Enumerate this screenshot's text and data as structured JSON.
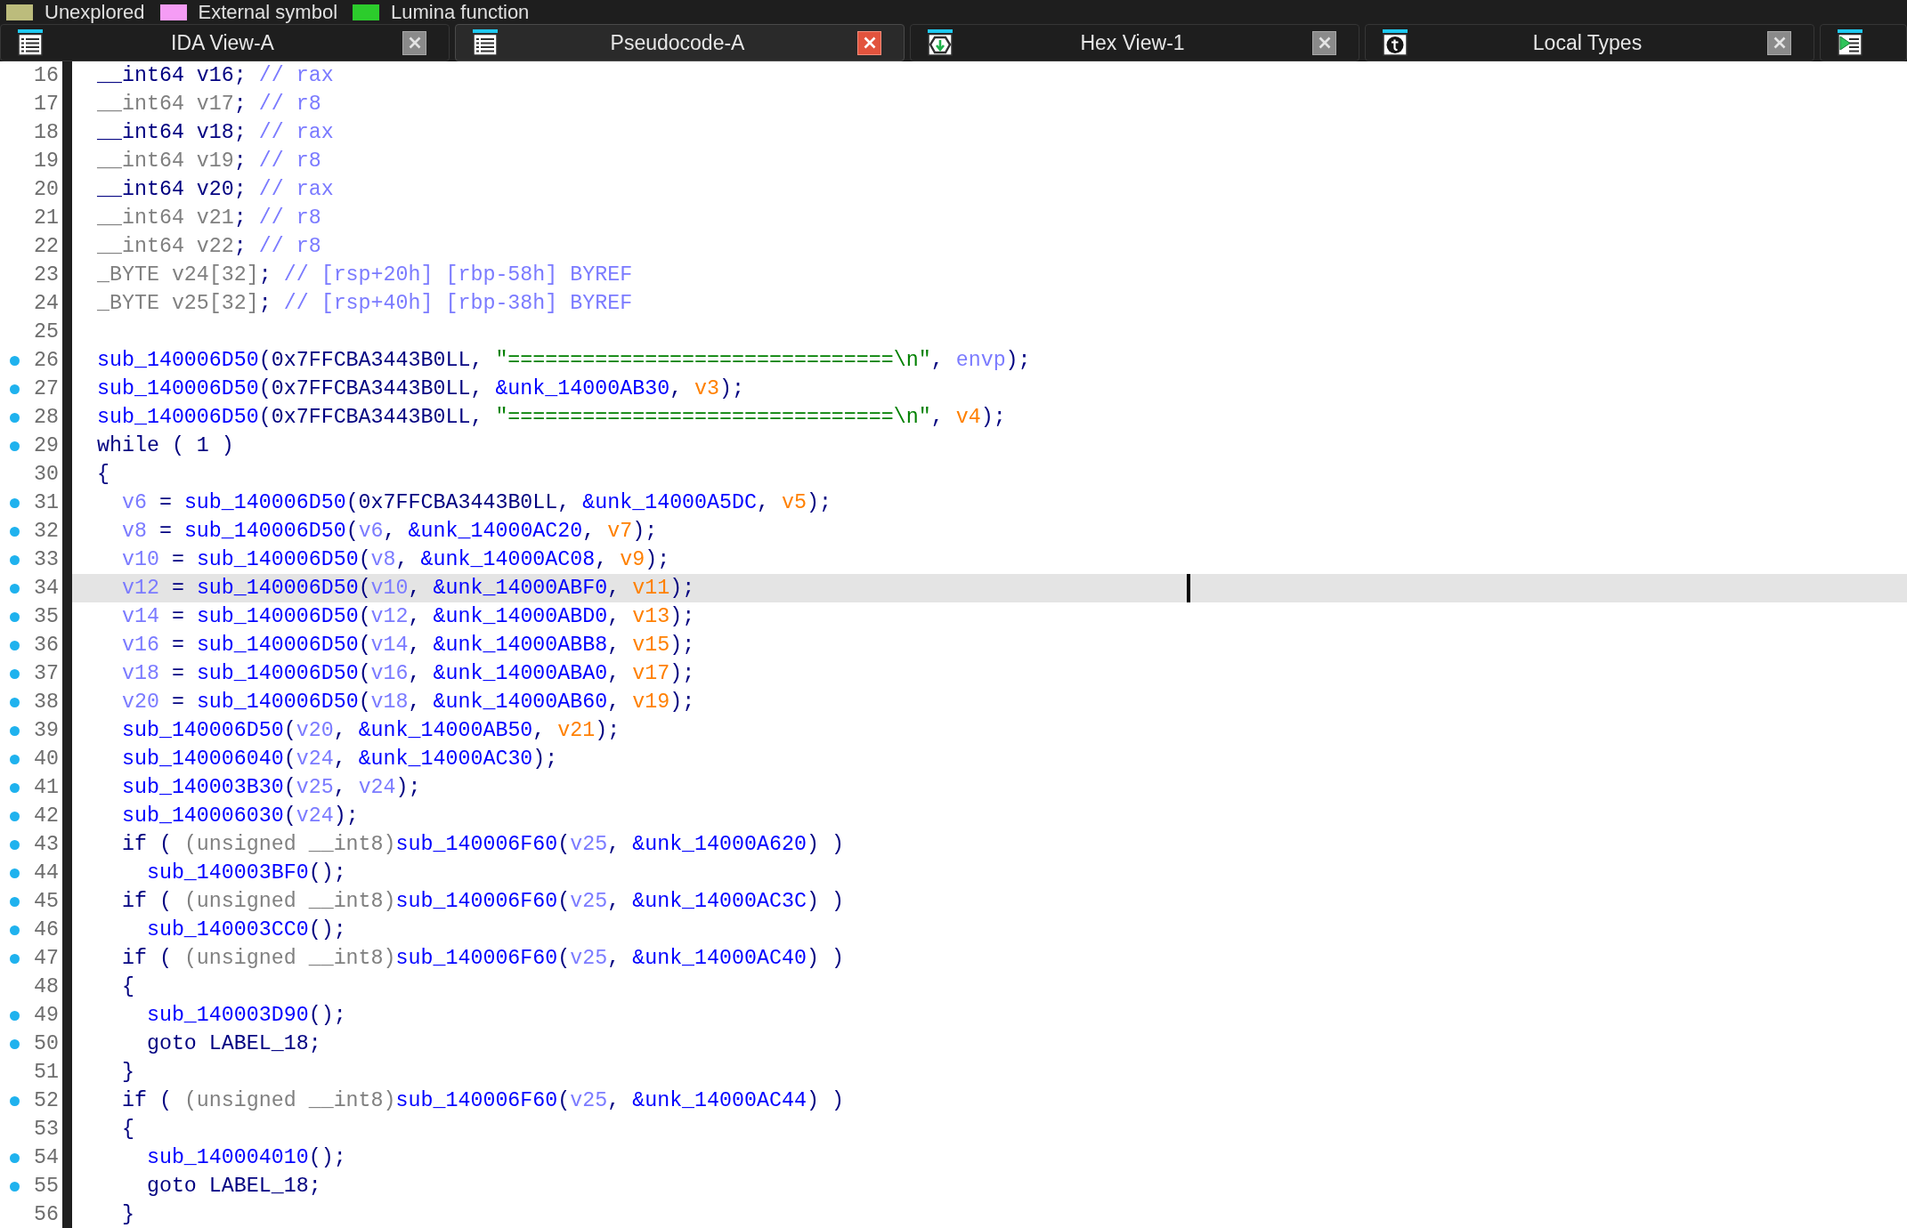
{
  "legend": [
    {
      "label": "Unexplored",
      "color": "#bcbc7c"
    },
    {
      "label": "External symbol",
      "color": "#f59cf5"
    },
    {
      "label": "Lumina function",
      "color": "#2ccc2c"
    }
  ],
  "tabs": [
    {
      "kind": "listing",
      "label": "IDA View-A",
      "selected": false,
      "closable": true
    },
    {
      "kind": "listing",
      "label": "Pseudocode-A",
      "selected": true,
      "closable": true
    },
    {
      "kind": "hex",
      "label": "Hex View-1",
      "selected": false,
      "closable": true
    },
    {
      "kind": "types",
      "label": "Local Types",
      "selected": false,
      "closable": true
    },
    {
      "kind": "exports",
      "selected": false
    }
  ],
  "code": {
    "lines": [
      {
        "number": "16",
        "marker": false,
        "selected": false,
        "tokens": [
          {
            "kind": "plain",
            "text": "__int64 v16; "
          },
          {
            "kind": "comment",
            "text": "// rax"
          }
        ]
      },
      {
        "number": "17",
        "marker": false,
        "selected": false,
        "tokens": [
          {
            "kind": "dim",
            "text": "__int64 v17"
          },
          {
            "kind": "plain",
            "text": "; "
          },
          {
            "kind": "comment",
            "text": "// r8"
          }
        ]
      },
      {
        "number": "18",
        "marker": false,
        "selected": false,
        "tokens": [
          {
            "kind": "plain",
            "text": "__int64 v18; "
          },
          {
            "kind": "comment",
            "text": "// rax"
          }
        ]
      },
      {
        "number": "19",
        "marker": false,
        "selected": false,
        "tokens": [
          {
            "kind": "dim",
            "text": "__int64 v19"
          },
          {
            "kind": "plain",
            "text": "; "
          },
          {
            "kind": "comment",
            "text": "// r8"
          }
        ]
      },
      {
        "number": "20",
        "marker": false,
        "selected": false,
        "tokens": [
          {
            "kind": "plain",
            "text": "__int64 v20; "
          },
          {
            "kind": "comment",
            "text": "// rax"
          }
        ]
      },
      {
        "number": "21",
        "marker": false,
        "selected": false,
        "tokens": [
          {
            "kind": "dim",
            "text": "__int64 v21"
          },
          {
            "kind": "plain",
            "text": "; "
          },
          {
            "kind": "comment",
            "text": "// r8"
          }
        ]
      },
      {
        "number": "22",
        "marker": false,
        "selected": false,
        "tokens": [
          {
            "kind": "dim",
            "text": "__int64 v22"
          },
          {
            "kind": "plain",
            "text": "; "
          },
          {
            "kind": "comment",
            "text": "// r8"
          }
        ]
      },
      {
        "number": "23",
        "marker": false,
        "selected": false,
        "tokens": [
          {
            "kind": "dim",
            "text": "_BYTE v24[32]"
          },
          {
            "kind": "plain",
            "text": "; "
          },
          {
            "kind": "comment",
            "text": "// [rsp+20h] [rbp-58h] BYREF"
          }
        ]
      },
      {
        "number": "24",
        "marker": false,
        "selected": false,
        "tokens": [
          {
            "kind": "dim",
            "text": "_BYTE v25[32]"
          },
          {
            "kind": "plain",
            "text": "; "
          },
          {
            "kind": "comment",
            "text": "// [rsp+40h] [rbp-38h] BYREF"
          }
        ]
      },
      {
        "number": "25",
        "marker": false,
        "selected": false
      },
      {
        "number": "26",
        "marker": true,
        "selected": false,
        "tokens": [
          {
            "kind": "name",
            "text": "sub_140006D50"
          },
          {
            "kind": "plain",
            "text": "(0x7FFCBA3443B0LL, "
          },
          {
            "kind": "string",
            "text": "\"===============================\\n\""
          },
          {
            "kind": "plain",
            "text": ", "
          },
          {
            "kind": "local",
            "text": "envp"
          },
          {
            "kind": "plain",
            "text": ");"
          }
        ]
      },
      {
        "number": "27",
        "marker": true,
        "selected": false,
        "tokens": [
          {
            "kind": "name",
            "text": "sub_140006D50"
          },
          {
            "kind": "plain",
            "text": "(0x7FFCBA3443B0LL, "
          },
          {
            "kind": "name",
            "text": "&unk_14000AB30"
          },
          {
            "kind": "plain",
            "text": ", "
          },
          {
            "kind": "arg",
            "text": "v3"
          },
          {
            "kind": "plain",
            "text": ");"
          }
        ]
      },
      {
        "number": "28",
        "marker": true,
        "selected": false,
        "tokens": [
          {
            "kind": "name",
            "text": "sub_140006D50"
          },
          {
            "kind": "plain",
            "text": "(0x7FFCBA3443B0LL, "
          },
          {
            "kind": "string",
            "text": "\"===============================\\n\""
          },
          {
            "kind": "plain",
            "text": ", "
          },
          {
            "kind": "arg",
            "text": "v4"
          },
          {
            "kind": "plain",
            "text": ");"
          }
        ]
      },
      {
        "number": "29",
        "marker": true,
        "selected": false,
        "tokens": [
          {
            "kind": "plain",
            "text": "while ( 1 )"
          }
        ]
      },
      {
        "number": "30",
        "marker": false,
        "selected": false,
        "tokens": [
          {
            "kind": "plain",
            "text": "{"
          }
        ]
      },
      {
        "number": "31",
        "marker": true,
        "selected": false,
        "tokens": [
          {
            "kind": "local",
            "text": "  v6"
          },
          {
            "kind": "plain",
            "text": " = "
          },
          {
            "kind": "name",
            "text": "sub_140006D50"
          },
          {
            "kind": "plain",
            "text": "(0x7FFCBA3443B0LL, "
          },
          {
            "kind": "name",
            "text": "&unk_14000A5DC"
          },
          {
            "kind": "plain",
            "text": ", "
          },
          {
            "kind": "arg",
            "text": "v5"
          },
          {
            "kind": "plain",
            "text": ");"
          }
        ]
      },
      {
        "number": "32",
        "marker": true,
        "selected": false,
        "tokens": [
          {
            "kind": "local",
            "text": "  v8"
          },
          {
            "kind": "plain",
            "text": " = "
          },
          {
            "kind": "name",
            "text": "sub_140006D50"
          },
          {
            "kind": "plain",
            "text": "("
          },
          {
            "kind": "local",
            "text": "v6"
          },
          {
            "kind": "plain",
            "text": ", "
          },
          {
            "kind": "name",
            "text": "&unk_14000AC20"
          },
          {
            "kind": "plain",
            "text": ", "
          },
          {
            "kind": "arg",
            "text": "v7"
          },
          {
            "kind": "plain",
            "text": ");"
          }
        ]
      },
      {
        "number": "33",
        "marker": true,
        "selected": false,
        "tokens": [
          {
            "kind": "local",
            "text": "  v10"
          },
          {
            "kind": "plain",
            "text": " = "
          },
          {
            "kind": "name",
            "text": "sub_140006D50"
          },
          {
            "kind": "plain",
            "text": "("
          },
          {
            "kind": "local",
            "text": "v8"
          },
          {
            "kind": "plain",
            "text": ", "
          },
          {
            "kind": "name",
            "text": "&unk_14000AC08"
          },
          {
            "kind": "plain",
            "text": ", "
          },
          {
            "kind": "arg",
            "text": "v9"
          },
          {
            "kind": "plain",
            "text": ");"
          }
        ]
      },
      {
        "number": "34",
        "marker": true,
        "selected": true,
        "tokens": [
          {
            "kind": "local",
            "text": "  v12"
          },
          {
            "kind": "plain",
            "text": " = "
          },
          {
            "kind": "name",
            "text": "sub_140006D50"
          },
          {
            "kind": "plain",
            "text": "("
          },
          {
            "kind": "local",
            "text": "v10"
          },
          {
            "kind": "plain",
            "text": ", "
          },
          {
            "kind": "name",
            "text": "&unk_14000ABF0"
          },
          {
            "kind": "plain",
            "text": ", "
          },
          {
            "kind": "arg",
            "text": "v11"
          },
          {
            "kind": "plain",
            "text": ");"
          }
        ]
      },
      {
        "number": "35",
        "marker": true,
        "selected": false,
        "tokens": [
          {
            "kind": "local",
            "text": "  v14"
          },
          {
            "kind": "plain",
            "text": " = "
          },
          {
            "kind": "name",
            "text": "sub_140006D50"
          },
          {
            "kind": "plain",
            "text": "("
          },
          {
            "kind": "local",
            "text": "v12"
          },
          {
            "kind": "plain",
            "text": ", "
          },
          {
            "kind": "name",
            "text": "&unk_14000ABD0"
          },
          {
            "kind": "plain",
            "text": ", "
          },
          {
            "kind": "arg",
            "text": "v13"
          },
          {
            "kind": "plain",
            "text": ");"
          }
        ]
      },
      {
        "number": "36",
        "marker": true,
        "selected": false,
        "tokens": [
          {
            "kind": "local",
            "text": "  v16"
          },
          {
            "kind": "plain",
            "text": " = "
          },
          {
            "kind": "name",
            "text": "sub_140006D50"
          },
          {
            "kind": "plain",
            "text": "("
          },
          {
            "kind": "local",
            "text": "v14"
          },
          {
            "kind": "plain",
            "text": ", "
          },
          {
            "kind": "name",
            "text": "&unk_14000ABB8"
          },
          {
            "kind": "plain",
            "text": ", "
          },
          {
            "kind": "arg",
            "text": "v15"
          },
          {
            "kind": "plain",
            "text": ");"
          }
        ]
      },
      {
        "number": "37",
        "marker": true,
        "selected": false,
        "tokens": [
          {
            "kind": "local",
            "text": "  v18"
          },
          {
            "kind": "plain",
            "text": " = "
          },
          {
            "kind": "name",
            "text": "sub_140006D50"
          },
          {
            "kind": "plain",
            "text": "("
          },
          {
            "kind": "local",
            "text": "v16"
          },
          {
            "kind": "plain",
            "text": ", "
          },
          {
            "kind": "name",
            "text": "&unk_14000ABA0"
          },
          {
            "kind": "plain",
            "text": ", "
          },
          {
            "kind": "arg",
            "text": "v17"
          },
          {
            "kind": "plain",
            "text": ");"
          }
        ]
      },
      {
        "number": "38",
        "marker": true,
        "selected": false,
        "tokens": [
          {
            "kind": "local",
            "text": "  v20"
          },
          {
            "kind": "plain",
            "text": " = "
          },
          {
            "kind": "name",
            "text": "sub_140006D50"
          },
          {
            "kind": "plain",
            "text": "("
          },
          {
            "kind": "local",
            "text": "v18"
          },
          {
            "kind": "plain",
            "text": ", "
          },
          {
            "kind": "name",
            "text": "&unk_14000AB60"
          },
          {
            "kind": "plain",
            "text": ", "
          },
          {
            "kind": "arg",
            "text": "v19"
          },
          {
            "kind": "plain",
            "text": ");"
          }
        ]
      },
      {
        "number": "39",
        "marker": true,
        "selected": false,
        "tokens": [
          {
            "kind": "name",
            "text": "  sub_140006D50"
          },
          {
            "kind": "plain",
            "text": "("
          },
          {
            "kind": "local",
            "text": "v20"
          },
          {
            "kind": "plain",
            "text": ", "
          },
          {
            "kind": "name",
            "text": "&unk_14000AB50"
          },
          {
            "kind": "plain",
            "text": ", "
          },
          {
            "kind": "arg",
            "text": "v21"
          },
          {
            "kind": "plain",
            "text": ");"
          }
        ]
      },
      {
        "number": "40",
        "marker": true,
        "selected": false,
        "tokens": [
          {
            "kind": "name",
            "text": "  sub_140006040"
          },
          {
            "kind": "plain",
            "text": "("
          },
          {
            "kind": "local",
            "text": "v24"
          },
          {
            "kind": "plain",
            "text": ", "
          },
          {
            "kind": "name",
            "text": "&unk_14000AC30"
          },
          {
            "kind": "plain",
            "text": ");"
          }
        ]
      },
      {
        "number": "41",
        "marker": true,
        "selected": false,
        "tokens": [
          {
            "kind": "name",
            "text": "  sub_140003B30"
          },
          {
            "kind": "plain",
            "text": "("
          },
          {
            "kind": "local",
            "text": "v25"
          },
          {
            "kind": "plain",
            "text": ", "
          },
          {
            "kind": "local",
            "text": "v24"
          },
          {
            "kind": "plain",
            "text": ");"
          }
        ]
      },
      {
        "number": "42",
        "marker": true,
        "selected": false,
        "tokens": [
          {
            "kind": "name",
            "text": "  sub_140006030"
          },
          {
            "kind": "plain",
            "text": "("
          },
          {
            "kind": "local",
            "text": "v24"
          },
          {
            "kind": "plain",
            "text": ");"
          }
        ]
      },
      {
        "number": "43",
        "marker": true,
        "selected": false,
        "tokens": [
          {
            "kind": "plain",
            "text": "  if ( "
          },
          {
            "kind": "dim",
            "text": "(unsigned __int8)"
          },
          {
            "kind": "name",
            "text": "sub_140006F60"
          },
          {
            "kind": "plain",
            "text": "("
          },
          {
            "kind": "local",
            "text": "v25"
          },
          {
            "kind": "plain",
            "text": ", "
          },
          {
            "kind": "name",
            "text": "&unk_14000A620"
          },
          {
            "kind": "plain",
            "text": ") )"
          }
        ]
      },
      {
        "number": "44",
        "marker": true,
        "selected": false,
        "tokens": [
          {
            "kind": "name",
            "text": "    sub_140003BF0"
          },
          {
            "kind": "plain",
            "text": "();"
          }
        ]
      },
      {
        "number": "45",
        "marker": true,
        "selected": false,
        "tokens": [
          {
            "kind": "plain",
            "text": "  if ( "
          },
          {
            "kind": "dim",
            "text": "(unsigned __int8)"
          },
          {
            "kind": "name",
            "text": "sub_140006F60"
          },
          {
            "kind": "plain",
            "text": "("
          },
          {
            "kind": "local",
            "text": "v25"
          },
          {
            "kind": "plain",
            "text": ", "
          },
          {
            "kind": "name",
            "text": "&unk_14000AC3C"
          },
          {
            "kind": "plain",
            "text": ") )"
          }
        ]
      },
      {
        "number": "46",
        "marker": true,
        "selected": false,
        "tokens": [
          {
            "kind": "name",
            "text": "    sub_140003CC0"
          },
          {
            "kind": "plain",
            "text": "();"
          }
        ]
      },
      {
        "number": "47",
        "marker": true,
        "selected": false,
        "tokens": [
          {
            "kind": "plain",
            "text": "  if ( "
          },
          {
            "kind": "dim",
            "text": "(unsigned __int8)"
          },
          {
            "kind": "name",
            "text": "sub_140006F60"
          },
          {
            "kind": "plain",
            "text": "("
          },
          {
            "kind": "local",
            "text": "v25"
          },
          {
            "kind": "plain",
            "text": ", "
          },
          {
            "kind": "name",
            "text": "&unk_14000AC40"
          },
          {
            "kind": "plain",
            "text": ") )"
          }
        ]
      },
      {
        "number": "48",
        "marker": false,
        "selected": false,
        "tokens": [
          {
            "kind": "plain",
            "text": "  {"
          }
        ]
      },
      {
        "number": "49",
        "marker": true,
        "selected": false,
        "tokens": [
          {
            "kind": "name",
            "text": "    sub_140003D90"
          },
          {
            "kind": "plain",
            "text": "();"
          }
        ]
      },
      {
        "number": "50",
        "marker": true,
        "selected": false,
        "tokens": [
          {
            "kind": "plain",
            "text": "    goto LABEL_18;"
          }
        ]
      },
      {
        "number": "51",
        "marker": false,
        "selected": false,
        "tokens": [
          {
            "kind": "plain",
            "text": "  }"
          }
        ]
      },
      {
        "number": "52",
        "marker": true,
        "selected": false,
        "tokens": [
          {
            "kind": "plain",
            "text": "  if ( "
          },
          {
            "kind": "dim",
            "text": "(unsigned __int8)"
          },
          {
            "kind": "name",
            "text": "sub_140006F60"
          },
          {
            "kind": "plain",
            "text": "("
          },
          {
            "kind": "local",
            "text": "v25"
          },
          {
            "kind": "plain",
            "text": ", "
          },
          {
            "kind": "name",
            "text": "&unk_14000AC44"
          },
          {
            "kind": "plain",
            "text": ") )"
          }
        ]
      },
      {
        "number": "53",
        "marker": false,
        "selected": false,
        "tokens": [
          {
            "kind": "plain",
            "text": "  {"
          }
        ]
      },
      {
        "number": "54",
        "marker": true,
        "selected": false,
        "tokens": [
          {
            "kind": "name",
            "text": "    sub_140004010"
          },
          {
            "kind": "plain",
            "text": "();"
          }
        ]
      },
      {
        "number": "55",
        "marker": true,
        "selected": false,
        "tokens": [
          {
            "kind": "plain",
            "text": "    goto LABEL_18;"
          }
        ]
      },
      {
        "number": "56",
        "marker": false,
        "selected": false,
        "tokens": [
          {
            "kind": "plain",
            "text": "  }"
          }
        ]
      }
    ]
  }
}
